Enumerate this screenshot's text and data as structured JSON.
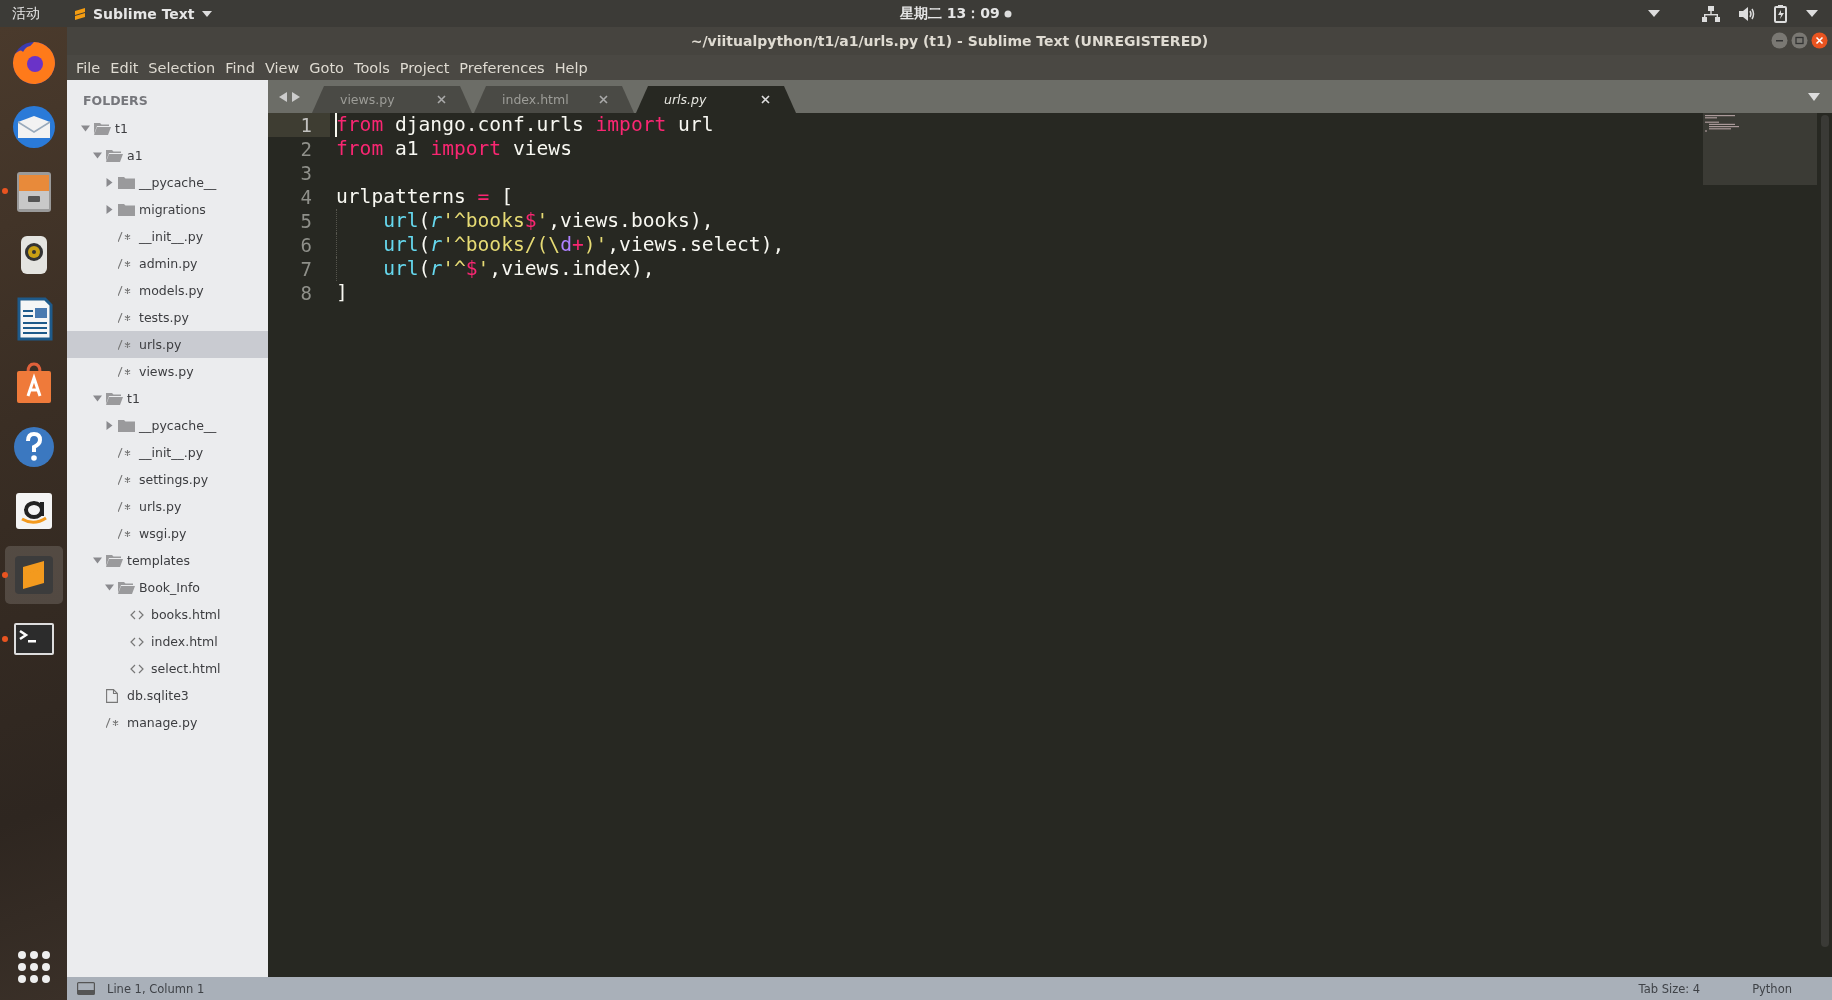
{
  "top_bar": {
    "activities": "活动",
    "app_menu": "Sublime Text",
    "clock": "星期二 13：09"
  },
  "dock": [
    {
      "kind": "firefox",
      "running": false,
      "selected": false
    },
    {
      "kind": "mail",
      "running": false,
      "selected": false
    },
    {
      "kind": "files",
      "running": true,
      "selected": false
    },
    {
      "kind": "speaker",
      "running": false,
      "selected": false
    },
    {
      "kind": "writer",
      "running": false,
      "selected": false
    },
    {
      "kind": "store",
      "running": false,
      "selected": false
    },
    {
      "kind": "help",
      "running": false,
      "selected": false
    },
    {
      "kind": "shop",
      "running": false,
      "selected": false
    },
    {
      "kind": "sublime",
      "running": true,
      "selected": true
    },
    {
      "kind": "terminal",
      "running": true,
      "selected": false
    }
  ],
  "window": {
    "title": "~/viitualpython/t1/a1/urls.py (t1) - Sublime Text (UNREGISTERED)"
  },
  "menu": [
    {
      "label": "File"
    },
    {
      "label": "Edit"
    },
    {
      "label": "Selection"
    },
    {
      "label": "Find"
    },
    {
      "label": "View"
    },
    {
      "label": "Goto"
    },
    {
      "label": "Tools"
    },
    {
      "label": "Project"
    },
    {
      "label": "Preferences"
    },
    {
      "label": "Help"
    }
  ],
  "tabs": [
    {
      "label": "views.py",
      "selected": false
    },
    {
      "label": "index.html",
      "selected": false
    },
    {
      "label": "urls.py",
      "selected": true
    }
  ],
  "sidebar": {
    "header": "FOLDERS",
    "tree": [
      {
        "name": "t1",
        "kind": "folder",
        "expanded": true,
        "selected": false,
        "children": [
          {
            "name": "a1",
            "kind": "folder",
            "expanded": true,
            "selected": false,
            "children": [
              {
                "name": "__pycache__",
                "kind": "folder",
                "expanded": false,
                "selected": false
              },
              {
                "name": "migrations",
                "kind": "folder",
                "expanded": false,
                "selected": false
              },
              {
                "name": "__init__.py",
                "kind": "python",
                "selected": false
              },
              {
                "name": "admin.py",
                "kind": "python",
                "selected": false
              },
              {
                "name": "models.py",
                "kind": "python",
                "selected": false
              },
              {
                "name": "tests.py",
                "kind": "python",
                "selected": false
              },
              {
                "name": "urls.py",
                "kind": "python",
                "selected": true
              },
              {
                "name": "views.py",
                "kind": "python",
                "selected": false
              }
            ]
          },
          {
            "name": "t1",
            "kind": "folder",
            "expanded": true,
            "selected": false,
            "children": [
              {
                "name": "__pycache__",
                "kind": "folder",
                "expanded": false,
                "selected": false
              },
              {
                "name": "__init__.py",
                "kind": "python",
                "selected": false
              },
              {
                "name": "settings.py",
                "kind": "python",
                "selected": false
              },
              {
                "name": "urls.py",
                "kind": "python",
                "selected": false
              },
              {
                "name": "wsgi.py",
                "kind": "python",
                "selected": false
              }
            ]
          },
          {
            "name": "templates",
            "kind": "folder",
            "expanded": true,
            "selected": false,
            "children": [
              {
                "name": "Book_Info",
                "kind": "folder",
                "expanded": true,
                "selected": false,
                "children": [
                  {
                    "name": "books.html",
                    "kind": "html",
                    "selected": false
                  },
                  {
                    "name": "index.html",
                    "kind": "html",
                    "selected": false
                  },
                  {
                    "name": "select.html",
                    "kind": "html",
                    "selected": false
                  }
                ]
              }
            ]
          },
          {
            "name": "db.sqlite3",
            "kind": "file",
            "selected": false
          },
          {
            "name": "manage.py",
            "kind": "python",
            "selected": false
          }
        ]
      }
    ]
  },
  "editor": {
    "lines": [
      {
        "number": "1",
        "current": true,
        "tokens": [
          {
            "text": "from",
            "kind": "keyword"
          },
          {
            "text": " django.conf.urls ",
            "kind": "plain"
          },
          {
            "text": "import",
            "kind": "keyword"
          },
          {
            "text": " url",
            "kind": "plain"
          }
        ]
      },
      {
        "number": "2",
        "current": false,
        "tokens": [
          {
            "text": "from",
            "kind": "keyword"
          },
          {
            "text": " a1 ",
            "kind": "plain"
          },
          {
            "text": "import",
            "kind": "keyword"
          },
          {
            "text": " views",
            "kind": "plain"
          }
        ]
      },
      {
        "number": "3",
        "current": false
      },
      {
        "number": "4",
        "current": false,
        "tokens": [
          {
            "text": "urlpatterns ",
            "kind": "plain"
          },
          {
            "text": "=",
            "kind": "keyword"
          },
          {
            "text": " [",
            "kind": "plain"
          }
        ]
      },
      {
        "number": "5",
        "current": false,
        "indented": true,
        "tokens": [
          {
            "text": "url",
            "kind": "func"
          },
          {
            "text": "(",
            "kind": "plain"
          },
          {
            "text": "r",
            "kind": "storage"
          },
          {
            "text": "'^books",
            "kind": "string"
          },
          {
            "text": "$",
            "kind": "keyword"
          },
          {
            "text": "'",
            "kind": "string"
          },
          {
            "text": ",views.books),",
            "kind": "plain"
          }
        ]
      },
      {
        "number": "6",
        "current": false,
        "indented": true,
        "tokens": [
          {
            "text": "url",
            "kind": "func"
          },
          {
            "text": "(",
            "kind": "plain"
          },
          {
            "text": "r",
            "kind": "storage"
          },
          {
            "text": "'^books/(\\",
            "kind": "string"
          },
          {
            "text": "d",
            "kind": "constant"
          },
          {
            "text": "+",
            "kind": "keyword"
          },
          {
            "text": ")'",
            "kind": "string"
          },
          {
            "text": ",views.select),",
            "kind": "plain"
          }
        ]
      },
      {
        "number": "7",
        "current": false,
        "indented": true,
        "tokens": [
          {
            "text": "url",
            "kind": "func"
          },
          {
            "text": "(",
            "kind": "plain"
          },
          {
            "text": "r",
            "kind": "storage"
          },
          {
            "text": "'^",
            "kind": "string"
          },
          {
            "text": "$",
            "kind": "keyword"
          },
          {
            "text": "'",
            "kind": "string"
          },
          {
            "text": ",views.index),",
            "kind": "plain"
          }
        ]
      },
      {
        "number": "8",
        "current": false,
        "tokens": [
          {
            "text": "]",
            "kind": "plain"
          }
        ]
      }
    ]
  },
  "status_bar": {
    "position": "Line 1, Column 1",
    "tab_size": "Tab Size: 4",
    "syntax": "Python"
  }
}
